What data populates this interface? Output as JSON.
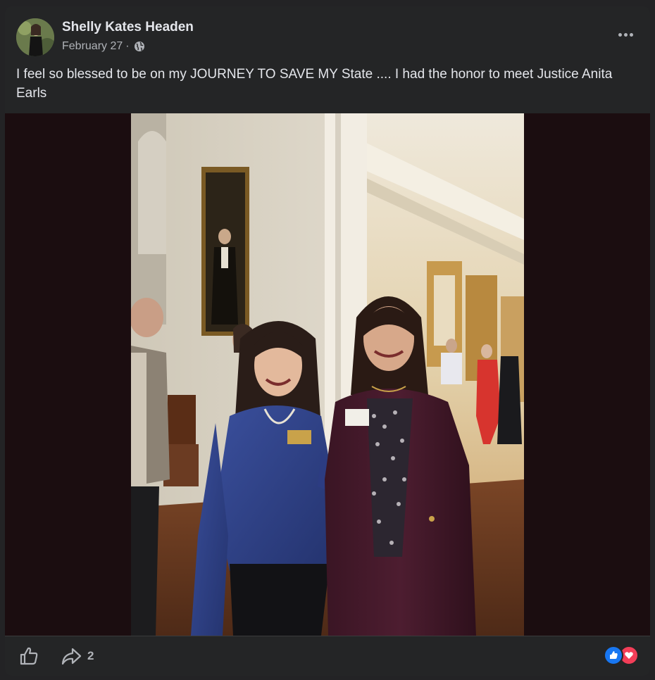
{
  "post": {
    "author_name": "Shelly Kates Headen",
    "date": "February 27",
    "separator": "·",
    "text": "I feel so blessed to be on my JOURNEY TO SAVE MY State .... I had the honor to meet Justice Anita Earls"
  },
  "actions": {
    "share_count": "2"
  },
  "icons": {
    "privacy": "globe-icon",
    "menu": "more-options-icon",
    "like": "thumbs-up-icon",
    "share": "share-arrow-icon",
    "reaction_like": "like-reaction-icon",
    "reaction_love": "love-reaction-icon"
  },
  "colors": {
    "card_bg": "#242526",
    "text_primary": "#e4e6eb",
    "text_secondary": "#b0b3b8",
    "like_blue": "#1877f2",
    "love_red": "#f33e58"
  }
}
